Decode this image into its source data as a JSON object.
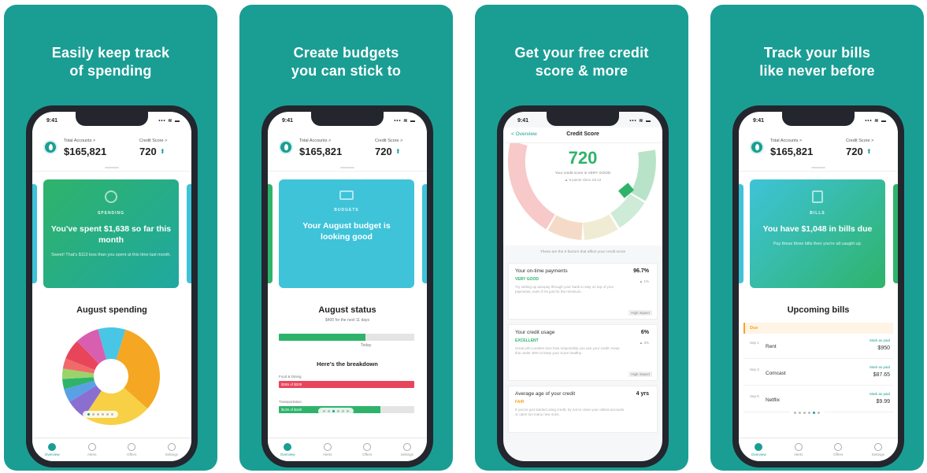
{
  "colors": {
    "bg": "#1a9e94",
    "accent": "#1a9e94",
    "green": "#2fb36b",
    "blue": "#3ec3d9",
    "red": "#e8455b",
    "orange": "#f5a623"
  },
  "status": {
    "time": "9:41",
    "signal": "••• ≋ ▬"
  },
  "header": {
    "accounts_label": "Total Accounts >",
    "accounts_value": "$165,821",
    "score_label": "Credit Score >",
    "score_value": "720",
    "score_arrow": "⬆"
  },
  "tabs": [
    "Overview",
    "Alerts",
    "Offers",
    "Settings"
  ],
  "panels": [
    {
      "heading": "Easily keep track of spending",
      "card": {
        "tag": "SPENDING",
        "title": "You've spent $1,638 so far this month",
        "sub": "Sweet! That's $113 less than you spent at this time last month."
      },
      "section_title": "August spending"
    },
    {
      "heading": "Create budgets you can stick to",
      "card": {
        "tag": "BUDGETS",
        "title": "Your August budget is looking good",
        "sub": ""
      },
      "section_title": "August status",
      "section_sub": "$400 for the next 11 days",
      "today_label": "Today",
      "overall_progress": 0.64,
      "breakdown_title": "Here's the breakdown",
      "categories": [
        {
          "name": "Food & Dining",
          "amount": "$265 of $200",
          "progress": 1.0,
          "color": "#e8455b"
        },
        {
          "name": "Transportation",
          "amount": "$135 of $180",
          "progress": 0.75,
          "color": "#2fb36b"
        }
      ]
    },
    {
      "heading": "Get your free credit score & more",
      "back_label": "< Overview",
      "title": "Credit Score",
      "score": "720",
      "score_text": "Your credit score is VERY GOOD",
      "score_change": "▲ 6 points since Jul 12",
      "factors_intro": "These are the 6 factors that affect your credit score",
      "factors": [
        {
          "name": "Your on-time payments",
          "value": "96.7%",
          "grade": "VERY GOOD",
          "grade_color": "#2fb36b",
          "change": "▲ 1%",
          "desc": "Try setting up autopay through your bank to stay on top of your payments, even if it's just for the minimum.",
          "impact": "High impact"
        },
        {
          "name": "Your credit usage",
          "value": "6%",
          "grade": "EXCELLENT",
          "grade_color": "#2fb36b",
          "change": "▲ 3%",
          "desc": "Great job! Lenders love how responsibly you use your credit. Keep this under 30% to keep your score healthy.",
          "impact": "High impact"
        },
        {
          "name": "Average age of your credit",
          "value": "4 yrs",
          "grade": "FAIR",
          "grade_color": "#f5a623",
          "change": "",
          "desc": "If you've just started using credit, try not to close your oldest accounts or open too many new ones.",
          "impact": ""
        }
      ]
    },
    {
      "heading": "Track your bills like never before",
      "card": {
        "tag": "BILLS",
        "title": "You have $1,048 in bills due",
        "sub": "Pay these three bills then you're all caught up."
      },
      "section_title": "Upcoming bills",
      "due_label": "Due",
      "bills": [
        {
          "date": "Sep 1",
          "name": "Rent",
          "link": "Mark as paid",
          "amount": "$950"
        },
        {
          "date": "Sep 3",
          "name": "Comcast",
          "link": "Mark as paid",
          "amount": "$87.65"
        },
        {
          "date": "Sep 5",
          "name": "Netflix",
          "link": "Mark as paid",
          "amount": "$9.99"
        }
      ]
    }
  ],
  "chart_data": {
    "type": "pie",
    "title": "August spending",
    "categories": [
      "",
      "",
      "",
      "",
      "",
      "",
      "",
      "",
      "",
      ""
    ],
    "values": [
      28,
      20,
      6,
      4,
      3,
      3,
      3,
      6,
      7,
      8
    ],
    "colors": [
      "#f5a623",
      "#f7d046",
      "#8a6fd1",
      "#5aa0e6",
      "#2fb36b",
      "#9bd36b",
      "#f06a6a",
      "#e8455b",
      "#d85fb0",
      "#49c6e5"
    ]
  }
}
